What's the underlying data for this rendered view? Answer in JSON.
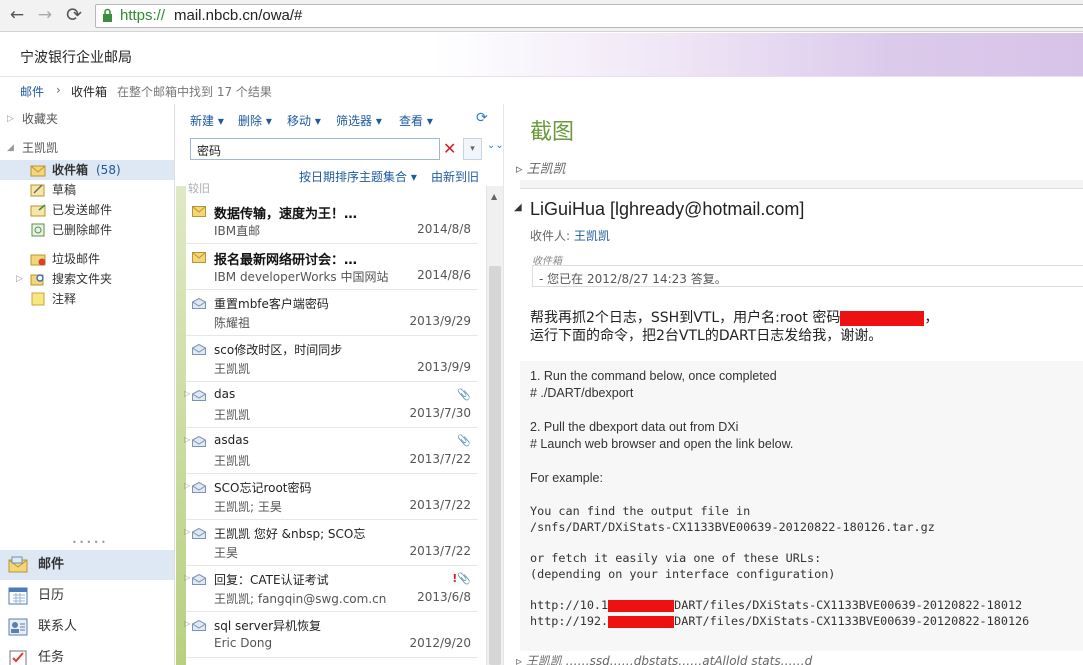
{
  "browser": {
    "back": "←",
    "forward": "→",
    "reload": "⟳",
    "url_scheme": "https://",
    "url_rest": "mail.nbcb.cn/owa/#"
  },
  "header": {
    "brand": "宁波银行企业邮局"
  },
  "breadcrumb": {
    "root": "邮件",
    "sep": "›",
    "folder": "收件箱",
    "result": "在整个邮箱中找到 17 个结果"
  },
  "nav": {
    "favorites": "收藏夹",
    "account": "王凯凯",
    "folders": [
      {
        "label": "收件箱",
        "count": "(58)"
      },
      {
        "label": "草稿"
      },
      {
        "label": "已发送邮件"
      },
      {
        "label": "已删除邮件"
      },
      {
        "label": "垃圾邮件"
      },
      {
        "label": "搜索文件夹"
      },
      {
        "label": "注释"
      }
    ],
    "dots": "• • • • •",
    "modules": [
      "邮件",
      "日历",
      "联系人",
      "任务"
    ]
  },
  "toolbar": {
    "new": "新建",
    "delete": "删除",
    "move": "移动",
    "filter": "筛选器",
    "view": "查看"
  },
  "search": {
    "value": "密码"
  },
  "sort": {
    "by": "按日期排序主题集合",
    "order": "由新到旧"
  },
  "list_partial": "较旧",
  "messages": [
    {
      "subject": "数据传输，速度为王！…",
      "from": "IBM直邮",
      "date": "2014/8/8",
      "bold": true,
      "flags": ""
    },
    {
      "subject": "报名最新网络研讨会：…",
      "from": "IBM developerWorks 中国网站",
      "date": "2014/8/6",
      "bold": true,
      "flags": ""
    },
    {
      "subject": "重置mbfe客户端密码",
      "from": "陈耀祖",
      "date": "2013/9/29",
      "bold": false,
      "flags": ""
    },
    {
      "subject": "sco修改时区，时间同步",
      "from": "王凯凯",
      "date": "2013/9/9",
      "bold": false,
      "flags": ""
    },
    {
      "subject": "das",
      "from": "王凯凯",
      "date": "2013/7/30",
      "bold": false,
      "flags": "📎"
    },
    {
      "subject": "asdas",
      "from": "王凯凯",
      "date": "2013/7/22",
      "bold": false,
      "flags": "📎"
    },
    {
      "subject": "SCO忘记root密码",
      "from": "王凯凯; 王昊",
      "date": "2013/7/22",
      "bold": false,
      "flags": ""
    },
    {
      "subject": "王凯凯 您好 &nbsp; SCO忘",
      "from": "王昊",
      "date": "2013/7/22",
      "bold": false,
      "flags": ""
    },
    {
      "subject": "回复：CATE认证考试",
      "from": "王凯凯; fangqin@swg.com.cn",
      "date": "2013/6/8",
      "bold": false,
      "flags": "!📎"
    },
    {
      "subject": "sql server异机恢复",
      "from": "Eric Dong",
      "date": "2012/9/20",
      "bold": false,
      "flags": ""
    }
  ],
  "reading": {
    "title": "截图",
    "collapsed_sender": "王凯凯",
    "sender": "LiGuiHua [lghready@hotmail.com]",
    "recipients_label": "收件人:",
    "recipient": "王凯凯",
    "info_label": "收件箱",
    "info": "- 您已在 2012/8/27 14:23 答复。",
    "body_line1_a": "帮我再抓2个日志，SSH到VTL，用户名:root 密码",
    "body_line1_b": "，",
    "body_line2": "运行下面的命令，把2台VTL的DART日志发给我，谢谢。",
    "steps": [
      "1. Run the command below, once completed",
      "# ./DART/dbexport",
      "2. Pull the dbexport data out from DXi",
      "# Launch web browser and open the link below.",
      "For example:"
    ],
    "mono": [
      "You can find the output file in",
      "/snfs/DART/DXiStats-CX1133BVE00639-20120822-180126.tar.gz",
      "or fetch it easily via one of these URLs:",
      "(depending on your interface configuration)"
    ],
    "url1_a": "http://10.1",
    "url1_b": "DART/files/DXiStats-CX1133BVE00639-20120822-18012",
    "url2_a": "http://192.",
    "url2_b": "DART/files/DXiStats-CX1133BVE00639-20120822-180126",
    "bottom_collapsed": "王凯凯     ……ssd……dbstats……atAllold stats……d"
  }
}
